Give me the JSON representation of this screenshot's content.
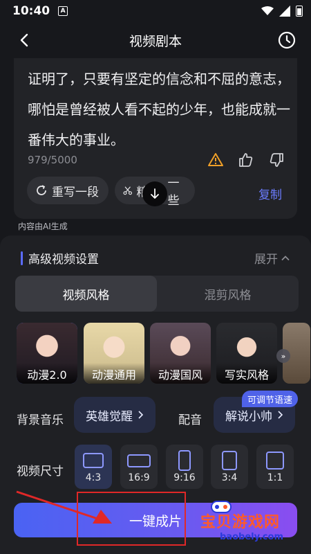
{
  "status_bar": {
    "time": "10:40",
    "notification_glyph": "A"
  },
  "header": {
    "title": "视频剧本"
  },
  "script_card": {
    "text": "证明了，只要有坚定的信念和不屈的意志，哪怕是曾经被人看不起的少年，也能成就一番伟大的事业。",
    "counter": "979/5000",
    "rewrite_label": "重写一段",
    "trim_label_start": "精",
    "trim_label_end": "一些",
    "copy_label": "复制"
  },
  "ai_note": "内容由AI生成",
  "advanced": {
    "title": "高级视频设置",
    "expand_label": "展开",
    "tabs": [
      "视频风格",
      "混剪风格"
    ],
    "styles": [
      "动漫2.0",
      "动漫通用",
      "动漫国风",
      "写实风格"
    ],
    "music_label": "背景音乐",
    "music_value": "英雄觉醒",
    "voice_label": "配音",
    "voice_value": "解说小帅",
    "voice_badge": "可调节语速",
    "size_label": "视频尺寸",
    "sizes": [
      "4:3",
      "16:9",
      "9:16",
      "3:4",
      "1:1"
    ],
    "selected_size": "4:3"
  },
  "cta": {
    "label": "一键成片"
  },
  "watermark": {
    "title": "宝贝游戏网",
    "sub": "baobely.com"
  },
  "colors": {
    "accent": "#6b7cff",
    "annotation": "#e02828"
  }
}
